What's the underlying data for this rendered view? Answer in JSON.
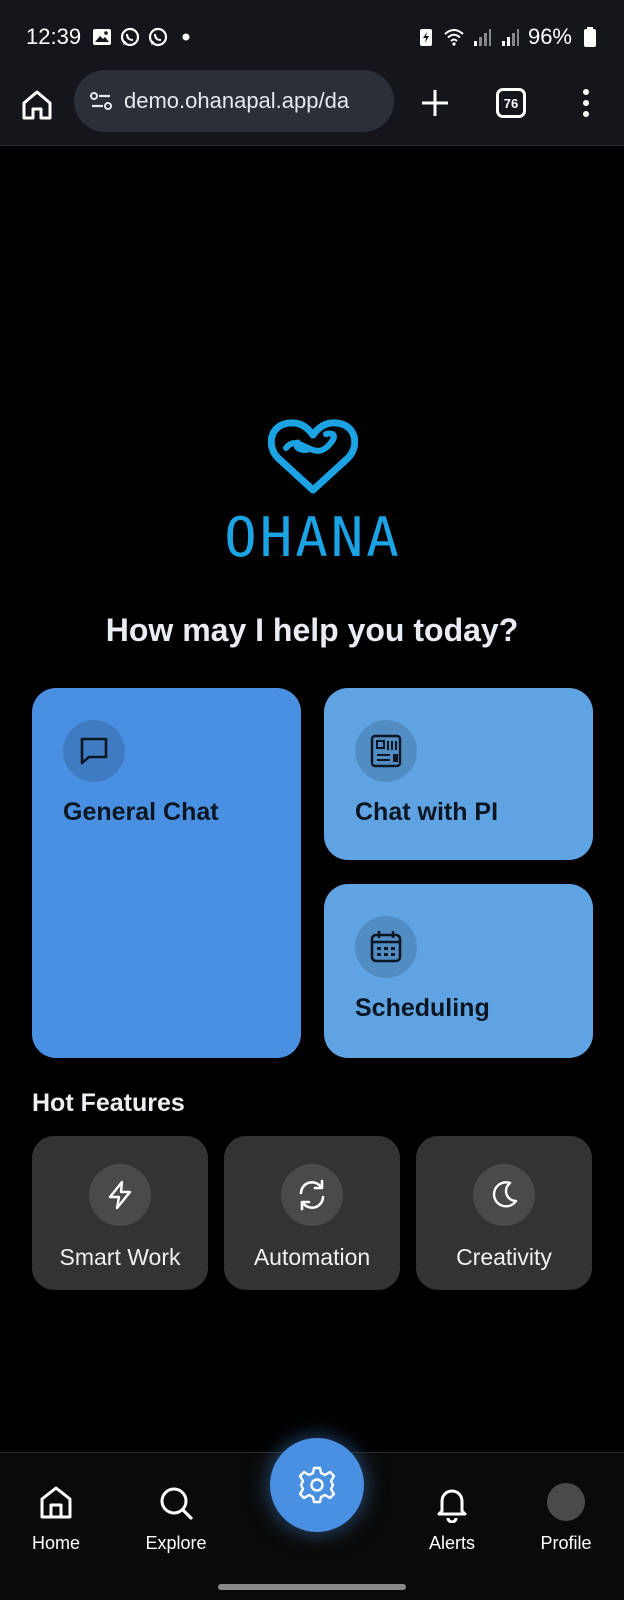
{
  "status_bar": {
    "time": "12:39",
    "battery": "96%",
    "left_icons": [
      "image-icon",
      "whatsapp-icon",
      "whatsapp-icon",
      "dot-icon"
    ],
    "right_icons": [
      "battery-saver-icon",
      "wifi-icon",
      "signal-icon",
      "signal-icon",
      "battery-icon"
    ]
  },
  "browser": {
    "url": "demo.ohanapal.app/da",
    "tab_count": "76"
  },
  "logo": {
    "text": "OHANA",
    "color": "#1ca3e4"
  },
  "headline": "How may I help you today?",
  "cards": [
    {
      "label": "General Chat",
      "icon": "chat-bubble-icon",
      "color": "#4a90e2"
    },
    {
      "label": "Chat with PI",
      "icon": "pi-board-icon",
      "color": "#5fa3e3"
    },
    {
      "label": "Scheduling",
      "icon": "calendar-icon",
      "color": "#5fa3e3"
    }
  ],
  "hot_features": {
    "title": "Hot Features",
    "items": [
      {
        "label": "Smart Work",
        "icon": "lightning-icon"
      },
      {
        "label": "Automation",
        "icon": "refresh-icon"
      },
      {
        "label": "Creativity",
        "icon": "moon-icon"
      }
    ]
  },
  "bottom_nav": {
    "items": [
      {
        "label": "Home",
        "icon": "home-icon"
      },
      {
        "label": "Explore",
        "icon": "search-icon"
      },
      {
        "label": "Alerts",
        "icon": "bell-icon"
      },
      {
        "label": "Profile",
        "icon": "avatar"
      }
    ],
    "center_button_icon": "gear-icon",
    "accent": "#4a90e2"
  }
}
